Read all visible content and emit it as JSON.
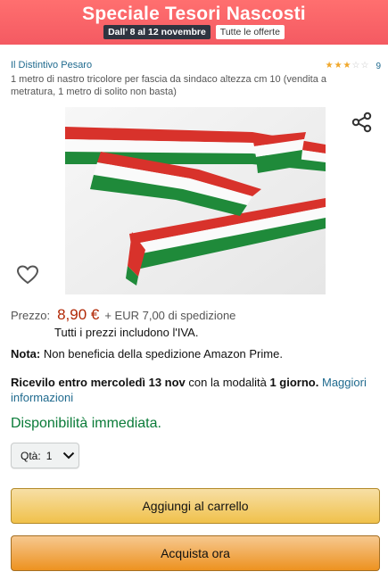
{
  "banner": {
    "title": "Speciale Tesori Nascosti",
    "dates": "Dall’ 8 al 12 novembre",
    "offers_link": "Tutte le offerte",
    "background_color": "#f45a62"
  },
  "product": {
    "seller": "Il Distintivo Pesaro",
    "rating_stars": 3,
    "rating_max": 5,
    "rating_count": "9",
    "title": "1 metro di nastro tricolore per fascia da sindaco altezza cm 10 (vendita a metratura, 1 metro di solito non basta)"
  },
  "icons": {
    "share": "share-icon",
    "wishlist": "heart-icon",
    "dropdown": "chevron-down-icon"
  },
  "pricing": {
    "label": "Prezzo:",
    "price": "8,90 €",
    "shipping": "+ EUR 7,00 di spedizione",
    "vat_note": "Tutti i prezzi includono l'IVA.",
    "price_color": "#b12704"
  },
  "note": {
    "label": "Nota:",
    "text": "Non beneficia della spedizione Amazon Prime."
  },
  "delivery": {
    "prefix": "Ricevilo entro mercoledì 13 nov",
    "middle": " con la modalità ",
    "mode": "1 giorno.",
    "link": "Maggiori informazioni"
  },
  "availability": {
    "text": "Disponibilità immediata.",
    "color": "#0a7b38"
  },
  "quantity": {
    "label": "Qtà:",
    "value": "1"
  },
  "buttons": {
    "add_to_cart": "Aggiungi al carrello",
    "buy_now": "Acquista ora"
  }
}
